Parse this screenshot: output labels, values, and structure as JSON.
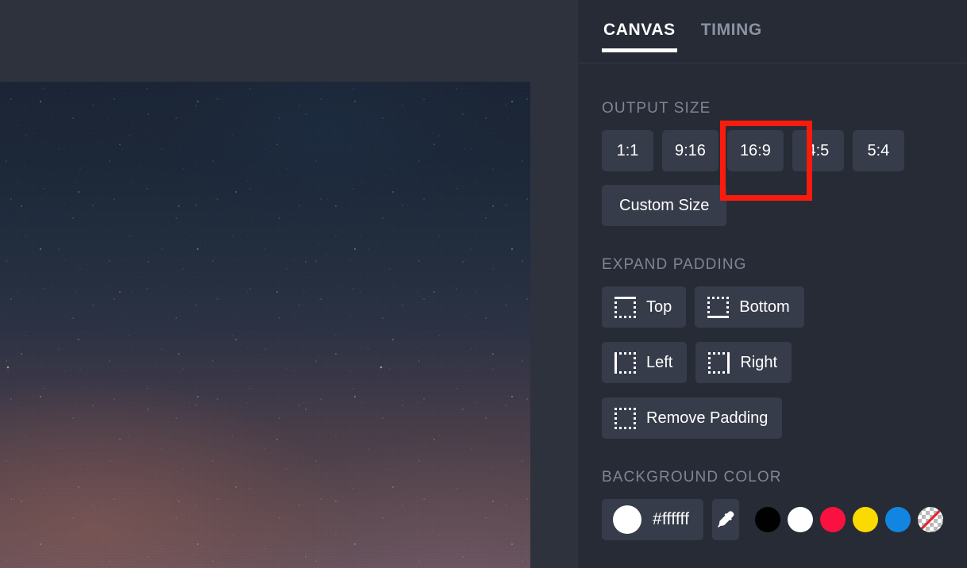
{
  "tabs": [
    {
      "label": "CANVAS",
      "active": true
    },
    {
      "label": "TIMING",
      "active": false
    }
  ],
  "canvas": {
    "preview_alt": "night-sky-photo"
  },
  "output_size": {
    "title": "OUTPUT SIZE",
    "ratios": [
      "1:1",
      "9:16",
      "16:9",
      "4:5",
      "5:4"
    ],
    "selected_ratio": "16:9",
    "custom_label": "Custom Size"
  },
  "expand_padding": {
    "title": "EXPAND PADDING",
    "buttons": [
      {
        "label": "Top",
        "icon": "padding-top-icon"
      },
      {
        "label": "Bottom",
        "icon": "padding-bottom-icon"
      },
      {
        "label": "Left",
        "icon": "padding-left-icon"
      },
      {
        "label": "Right",
        "icon": "padding-right-icon"
      },
      {
        "label": "Remove Padding",
        "icon": "padding-remove-icon"
      }
    ]
  },
  "background_color": {
    "title": "BACKGROUND COLOR",
    "hex_value": "#ffffff",
    "eyedropper_icon": "eyedropper-icon",
    "swatches": [
      {
        "name": "black",
        "color": "#010101"
      },
      {
        "name": "white",
        "color": "#ffffff"
      },
      {
        "name": "red",
        "color": "#f9123f"
      },
      {
        "name": "yellow",
        "color": "#fada00"
      },
      {
        "name": "blue",
        "color": "#1185e0"
      },
      {
        "name": "transparent",
        "color": "transparent"
      }
    ]
  },
  "annotation": {
    "highlight_target": "16:9",
    "highlight_color": "#fb1b0c"
  }
}
